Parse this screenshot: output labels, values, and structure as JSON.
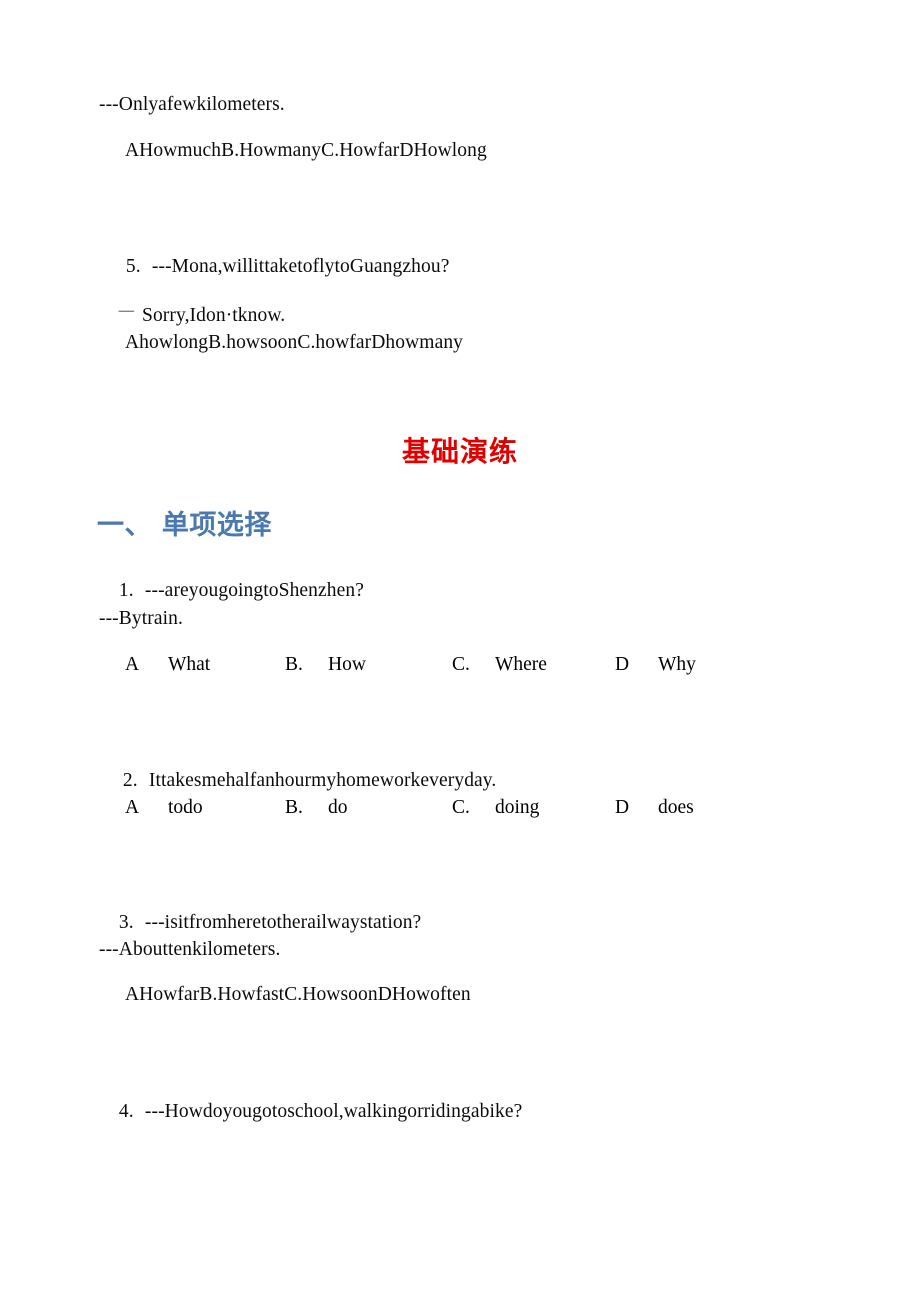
{
  "document": {
    "type": "english-grammar-worksheet",
    "background_color": "#ffffff",
    "text_color": "#0b0b0b",
    "accent_red": "#e00000",
    "accent_blue": "#4a78b0"
  },
  "top_section": {
    "answer_line": "---Onlyafewkilometers.",
    "inline_choices": "AHowmuchB.HowmanyC.HowfarDHowlong",
    "q5": {
      "number": "5.",
      "prompt": "---Mona,willittaketoflytoGuangzhou?",
      "reply_dash": "一",
      "reply": "Sorry,Idon·tknow.",
      "inline_choices": "AhowlongB.howsoonC.howfarDhowmany"
    }
  },
  "banner": {
    "title": "基础演练"
  },
  "subheading": {
    "label": "一、 单项选择"
  },
  "questions": [
    {
      "number": "1.",
      "prompt": "---areyougoingtoShenzhen?",
      "reply": "---Bytrain.",
      "choices": [
        {
          "letter": "A",
          "text": "What"
        },
        {
          "letter": "B.",
          "text": "How"
        },
        {
          "letter": "C.",
          "text": "Where"
        },
        {
          "letter": "D",
          "text": "Why"
        }
      ]
    },
    {
      "number": "2.",
      "prompt": "Ittakesmehalfanhourmyhomeworkeveryday.",
      "choices": [
        {
          "letter": "A",
          "text": "todo"
        },
        {
          "letter": "B.",
          "text": "do"
        },
        {
          "letter": "C.",
          "text": "doing"
        },
        {
          "letter": "D",
          "text": "does"
        }
      ]
    },
    {
      "number": "3.",
      "prompt": "---isitfromheretotherailwaystation?",
      "reply": "---Abouttenkilometers.",
      "inline_choices": "AHowfarB.HowfastC.HowsoonDHowoften"
    },
    {
      "number": "4.",
      "prompt": "---Howdoyougotoschool,walkingorridingabike?"
    }
  ]
}
